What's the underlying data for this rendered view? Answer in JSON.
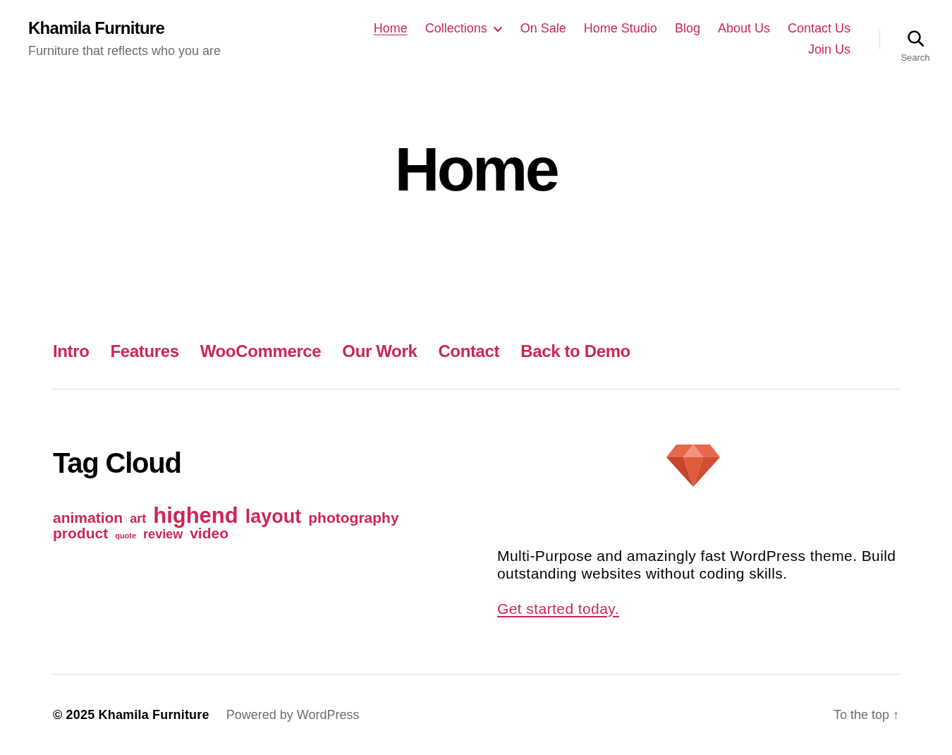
{
  "header": {
    "site_title": "Khamila Furniture",
    "tagline": "Furniture that reflects who you are",
    "nav": [
      {
        "label": "Home",
        "selected": true,
        "submenu": false
      },
      {
        "label": "Collections",
        "selected": false,
        "submenu": true
      },
      {
        "label": "On Sale",
        "selected": false,
        "submenu": false
      },
      {
        "label": "Home Studio",
        "selected": false,
        "submenu": false
      },
      {
        "label": "Blog",
        "selected": false,
        "submenu": false
      },
      {
        "label": "About Us",
        "selected": false,
        "submenu": false
      },
      {
        "label": "Contact Us",
        "selected": false,
        "submenu": false
      },
      {
        "label": "Join Us",
        "selected": false,
        "submenu": false
      }
    ],
    "search": {
      "label": "Search"
    }
  },
  "hero": {
    "title": "Home"
  },
  "section_nav": [
    {
      "label": "Intro"
    },
    {
      "label": "Features"
    },
    {
      "label": "WooCommerce"
    },
    {
      "label": "Our Work"
    },
    {
      "label": "Contact"
    },
    {
      "label": "Back to Demo"
    }
  ],
  "tag_cloud": {
    "title": "Tag Cloud",
    "tags": [
      {
        "label": "animation",
        "kind": "medium"
      },
      {
        "label": "art",
        "kind": "small"
      },
      {
        "label": "highend",
        "kind": "largest"
      },
      {
        "label": "layout",
        "kind": "large"
      },
      {
        "label": "photography",
        "kind": "medium"
      },
      {
        "label": "product",
        "kind": "medium"
      },
      {
        "label": "quote",
        "kind": "smallest"
      },
      {
        "label": "review",
        "kind": "small"
      },
      {
        "label": "video",
        "kind": "medium"
      }
    ]
  },
  "promo": {
    "text": "Multi-Purpose and amazingly fast WordPress theme. Build outstanding websites without coding skills.",
    "link": "Get started today."
  },
  "footer": {
    "copyright": "© 2025 Khamila Furniture",
    "powered_by": "Powered by WordPress",
    "to_top": "To the top ↑"
  }
}
